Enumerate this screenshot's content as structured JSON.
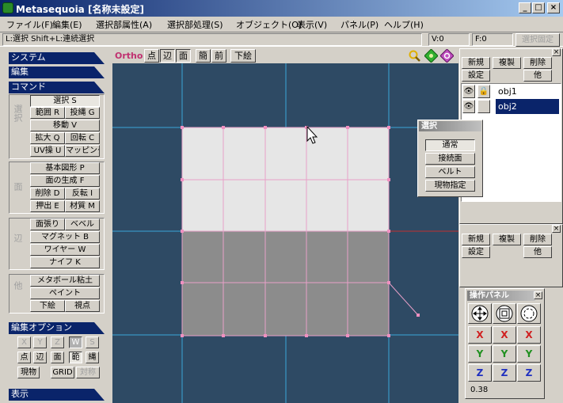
{
  "window": {
    "title": "Metasequoia [名称未設定]",
    "min": "_",
    "max": "□",
    "close": "×"
  },
  "menu": [
    "ファイル(F)",
    "編集(E)",
    "選択部属性(A)",
    "選択部処理(S)",
    "オブジェクト(O)",
    "表示(V)",
    "パネル(P)",
    "ヘルプ(H)"
  ],
  "status": {
    "hint": "L:選択  Shift+L:連続選択",
    "v": "V:0",
    "f": "F:0",
    "lock": "選択固定"
  },
  "sections": {
    "system": "システム",
    "edit": "編集",
    "command": "コマンド",
    "edit_options": "編集オプション",
    "display": "表示"
  },
  "groups": {
    "select": "選択",
    "face": "面",
    "edge": "辺",
    "misc": "他"
  },
  "commands": {
    "select": "選択 S",
    "range": "範囲 R",
    "lasso": "投縄 G",
    "move": "移動 V",
    "scale": "拡大 Q",
    "rotate": "回転 C",
    "uv": "UV操 U",
    "mapping": "マッピング",
    "primitive": "基本図形 P",
    "make_face": "面の生成 F",
    "delete": "削除 D",
    "flip": "反転 I",
    "extrude": "押出 E",
    "material": "材質 M",
    "face_paste": "面張り",
    "bevel": "ベベル",
    "magnet": "マグネット B",
    "wire": "ワイヤー W",
    "knife": "ナイフ K",
    "metaball": "メタボール粘土",
    "paint": "ペイント",
    "sketch": "下絵",
    "viewpoint": "視点"
  },
  "options": {
    "x": "X",
    "y": "Y",
    "z": "Z",
    "w": "W",
    "s": "S",
    "point": "点",
    "edge": "辺",
    "face": "面",
    "range": "範",
    "lasso": "縄",
    "object": "現物",
    "grid": "GRID",
    "symmetry": "対称"
  },
  "viewport_toolbar": {
    "mode": "Ortho",
    "point": "点",
    "edge": "辺",
    "face": "面",
    "simple": "簡",
    "front": "前",
    "sketch": "下絵"
  },
  "object_panel": {
    "new": "新規",
    "duplicate": "複製",
    "delete": "削除",
    "settings": "設定",
    "other": "他",
    "objects": [
      {
        "name": "obj1",
        "selected": false
      },
      {
        "name": "obj2",
        "selected": true
      }
    ]
  },
  "material_panel": {
    "new": "新規",
    "duplicate": "複製",
    "delete": "削除",
    "settings": "設定",
    "other": "他"
  },
  "select_popup": {
    "title": "選択",
    "items": [
      "通常",
      "接続面",
      "ベルト",
      "現物指定"
    ]
  },
  "op_panel": {
    "title": "操作パネル",
    "x": "X",
    "y": "Y",
    "z": "Z",
    "value": "0.38"
  },
  "colors": {
    "viewport": "#2e4a64",
    "grid": "#3aa6d8",
    "selection": "#e8a0c8",
    "top_faces": "#e6e6e6",
    "bottom_faces": "#8c8c8c",
    "axis_x": "#d02020",
    "axis_y": "#209020",
    "axis_z": "#2030c0"
  }
}
